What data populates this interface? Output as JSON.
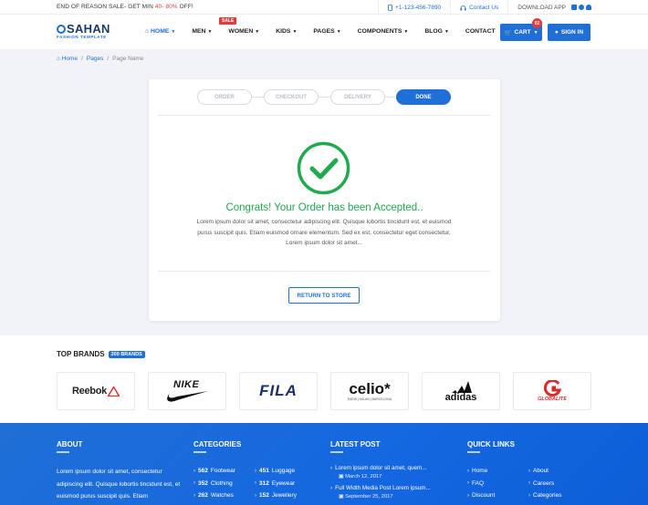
{
  "topbar": {
    "promo_prefix": "END OF REASON SALE- GET MIN ",
    "promo_highlight": "40- 80%",
    "promo_suffix": " OFF!",
    "phone": "+1-123-456-7890",
    "contact": "Contact Us",
    "download": "DOWNLOAD APP"
  },
  "nav": {
    "logo": "SAHAN",
    "logo_sub": "FASHION TEMPLATE",
    "items": [
      {
        "label": "HOME"
      },
      {
        "label": "MEN"
      },
      {
        "label": "WOMEN"
      },
      {
        "label": "KIDS"
      },
      {
        "label": "PAGES"
      },
      {
        "label": "COMPONENTS"
      },
      {
        "label": "BLOG"
      },
      {
        "label": "CONTACT"
      }
    ],
    "sale_badge": "SALE",
    "cart_label": "CART",
    "cart_count": "02",
    "signin_label": "SIGN IN"
  },
  "breadcrumb": [
    "Home",
    "Pages",
    "Page Name"
  ],
  "steps": [
    "ORDER",
    "CHECKOUT",
    "DELIVERY",
    "DONE"
  ],
  "confirmation": {
    "title": "Congrats! Your Order has been Accepted..",
    "description": "Lorem ipsum dolor sit amet, consectetur adipiscing elit. Quisque lobortis tincidunt est, et euismod purus suscipit quis. Etiam euismod ornare elementum. Sed ex est, consectetur eget consectetur, Lorem ipsum dolor sit amet...",
    "button": "RETURN TO STORE"
  },
  "brands": {
    "title": "TOP BRANDS",
    "badge": "200 BRANDS",
    "items": [
      "Reebok",
      "NIKE",
      "FILA",
      "celio*",
      "adidas",
      "GLOBALITE"
    ]
  },
  "footer": {
    "about_title": "ABOUT",
    "about_text": "Lorem ipsum dolor sit amet, consectetur adipiscing elit. Quisque lobortis tincidunt est, et euismod purus suscipit quis. Etiam",
    "categories_title": "CATEGORIES",
    "categories_left": [
      {
        "count": "562",
        "name": "Footwear"
      },
      {
        "count": "352",
        "name": "Clothing"
      },
      {
        "count": "262",
        "name": "Watches"
      }
    ],
    "categories_right": [
      {
        "count": "451",
        "name": "Luggage"
      },
      {
        "count": "312",
        "name": "Eyewear"
      },
      {
        "count": "152",
        "name": "Jewellery"
      }
    ],
    "latest_title": "LATEST POST",
    "posts": [
      {
        "title": "Lorem ipsum dolor sit amet, quem...",
        "date": "March 12, 2017"
      },
      {
        "title": "Full Width Media Post Lorem ipsum...",
        "date": "September 25, 2017"
      }
    ],
    "quick_title": "QUICK LINKS",
    "quick_left": [
      "Home",
      "FAQ",
      "Discount"
    ],
    "quick_right": [
      "About",
      "Careers",
      "Categories"
    ]
  }
}
